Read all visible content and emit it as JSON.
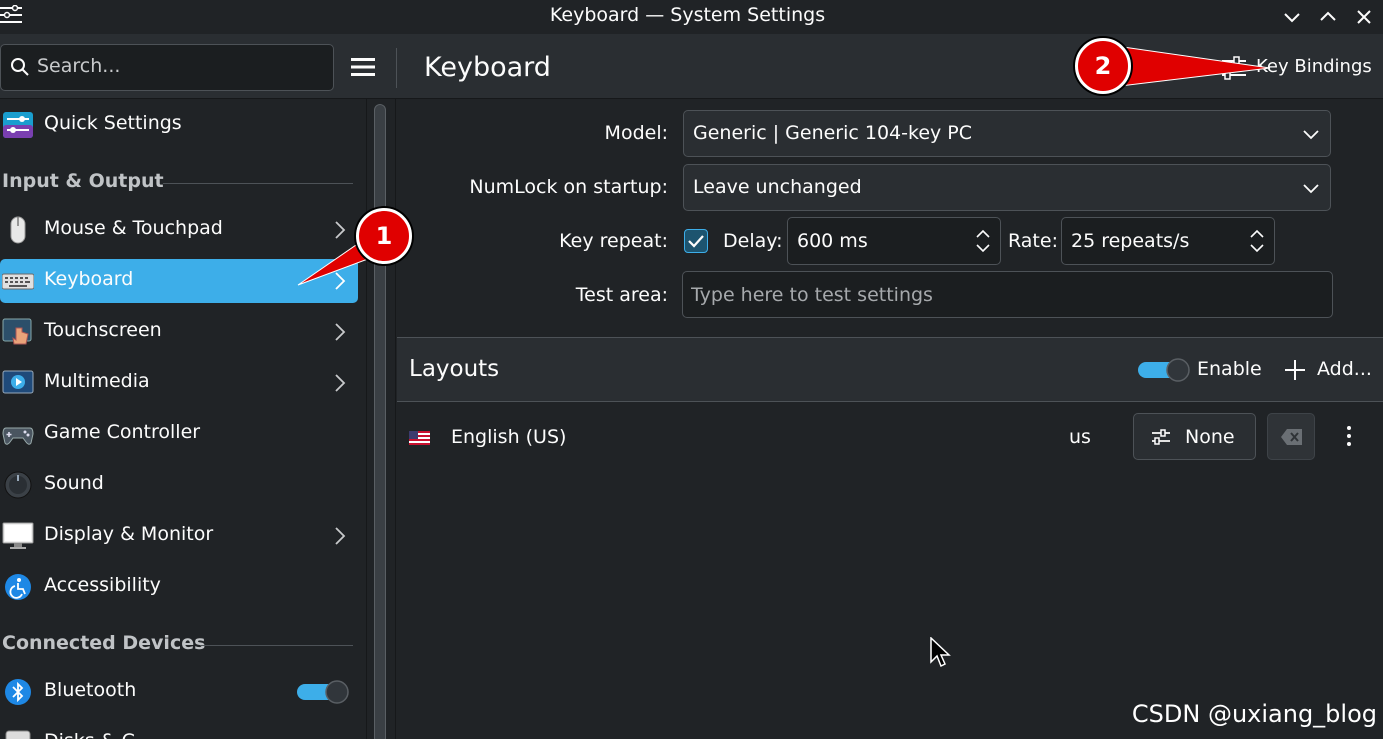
{
  "window": {
    "title": "Keyboard — System Settings",
    "buttons": [
      "minimize",
      "maximize",
      "close"
    ]
  },
  "header": {
    "search_placeholder": "Search...",
    "page_title": "Keyboard",
    "key_bindings_label": "Key Bindings"
  },
  "sidebar": {
    "quick_settings": "Quick Settings",
    "section_input_output": "Input & Output",
    "items": [
      {
        "label": "Mouse & Touchpad",
        "chevron": true
      },
      {
        "label": "Keyboard",
        "chevron": true,
        "selected": true
      },
      {
        "label": "Touchscreen",
        "chevron": true
      },
      {
        "label": "Multimedia",
        "chevron": true
      },
      {
        "label": "Game Controller",
        "chevron": false
      },
      {
        "label": "Sound",
        "chevron": false
      },
      {
        "label": "Display & Monitor",
        "chevron": true
      },
      {
        "label": "Accessibility",
        "chevron": false
      }
    ],
    "section_connected": "Connected Devices",
    "bluetooth": {
      "label": "Bluetooth",
      "toggle_on": true
    },
    "partial_item": "Disks & C..."
  },
  "form": {
    "model_label": "Model:",
    "model_value": "Generic | Generic 104-key PC",
    "numlock_label": "NumLock on startup:",
    "numlock_value": "Leave unchanged",
    "key_repeat_label": "Key repeat:",
    "key_repeat_checked": true,
    "delay_label": "Delay:",
    "delay_value": "600 ms",
    "rate_label": "Rate:",
    "rate_value": "25 repeats/s",
    "test_area_label": "Test area:",
    "test_area_placeholder": "Type here to test settings"
  },
  "layouts": {
    "title": "Layouts",
    "enable_label": "Enable",
    "enable_on": true,
    "add_label": "Add...",
    "rows": [
      {
        "name": "English (US)",
        "code": "us",
        "variant_label": "None"
      }
    ]
  },
  "annotations": {
    "badge1": "1",
    "badge2": "2"
  },
  "watermark": "CSDN @uxiang_blog",
  "colors": {
    "accent": "#3daee9",
    "annotation": "#e00000",
    "window_bg": "#202326",
    "header_bg": "#2a2e32"
  }
}
